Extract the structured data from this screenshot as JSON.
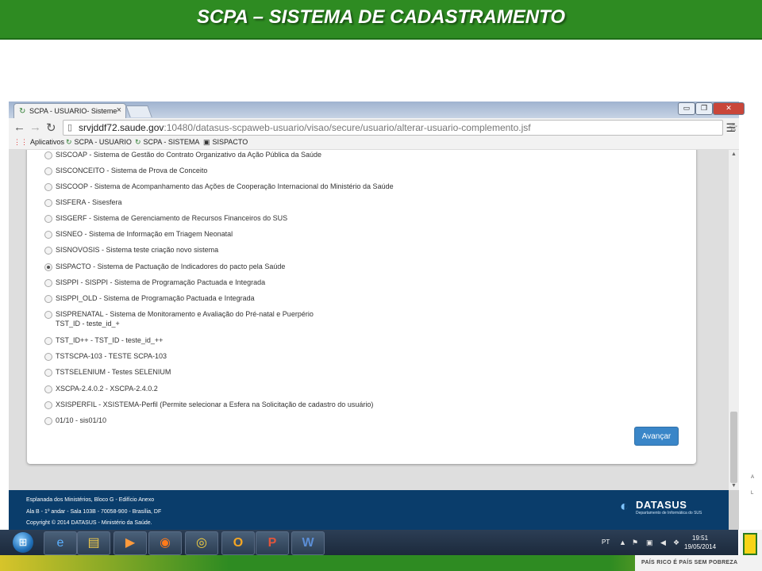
{
  "slide": {
    "title": "SCPA – SISTEMA DE CADASTRAMENTO"
  },
  "browser": {
    "tab_title": "SCPA - USUARIO- Sisteme",
    "tab_close": "×",
    "window_controls": {
      "minimize": "▭",
      "maximize": "❐",
      "close": "✕"
    },
    "url_host": "srvjddf72.saude.gov",
    "url_path": ":10480/datasus-scpaweb-usuario/visao/secure/usuario/alterar-usuario-complemento.jsf",
    "bookmarks": [
      {
        "label": "Aplicativos",
        "icon": "apps-grid-icon"
      },
      {
        "label": "SCPA - USUARIO",
        "icon": "scpa-icon"
      },
      {
        "label": "SCPA - SISTEMA",
        "icon": "scpa-icon"
      },
      {
        "label": "SISPACTO",
        "icon": "sispacto-icon"
      }
    ]
  },
  "page": {
    "systems": [
      {
        "label": "SISCOAP - Sistema de Gestão do Contrato Organizativo da Ação Pública da Saúde",
        "checked": false
      },
      {
        "label": "SISCONCEITO - Sistema de Prova de Conceito",
        "checked": false
      },
      {
        "label": "SISCOOP - Sistema de Acompanhamento das Ações de Cooperação Internacional do Ministério da Saúde",
        "checked": false
      },
      {
        "label": "SISFERA - Sisesfera",
        "checked": false
      },
      {
        "label": "SISGERF - Sistema de Gerenciamento de Recursos Financeiros do SUS",
        "checked": false
      },
      {
        "label": "SISNEO - Sistema de Informação em Triagem Neonatal",
        "checked": false
      },
      {
        "label": "SISNOVOSIS - Sistema teste criação novo sistema",
        "checked": false
      },
      {
        "label": "SISPACTO - Sistema de Pactuação de Indicadores do pacto pela Saúde",
        "checked": true
      },
      {
        "label": "SISPPI - SISPPI - Sistema de Programação Pactuada e Integrada",
        "checked": false
      },
      {
        "label": "SISPPI_OLD - Sistema de Programação Pactuada e Integrada",
        "checked": false
      },
      {
        "label": "SISPRENATAL - Sistema de Monitoramento e Avaliação do Pré-natal e Puerpério",
        "checked": false
      },
      {
        "label": "TST_ID - teste_id_+",
        "checked": false
      },
      {
        "label": "TST_ID++ - TST_ID - teste_id_++",
        "checked": false
      },
      {
        "label": "TSTSCPA-103 - TESTE SCPA-103",
        "checked": false
      },
      {
        "label": "TSTSELENIUM - Testes SELENIUM",
        "checked": false
      },
      {
        "label": "XSCPA-2.4.0.2 - XSCPA-2.4.0.2",
        "checked": false
      },
      {
        "label": "XSISPERFIL - XSISTEMA-Perfil (Permite selecionar a Esfera na Solicitação de cadastro do usuário)",
        "checked": false
      },
      {
        "label": "01/10 - sis01/10",
        "checked": false
      }
    ],
    "advance_button": "Avançar"
  },
  "footer": {
    "address_line1": "Esplanada dos Ministérios, Bloco G - Edifício Anexo",
    "address_line2": "Ala B - 1º andar - Sala 103B - 70058-900 - Brasília, DF",
    "copyright": "Copyright © 2014 DATASUS - Ministério da Saúde.",
    "logo_name": "DATASUS",
    "logo_subtitle": "Departamento de Informática do SUS"
  },
  "taskbar": {
    "apps": [
      {
        "name": "internet-explorer",
        "glyph": "e"
      },
      {
        "name": "file-explorer",
        "glyph": "▤"
      },
      {
        "name": "media-player",
        "glyph": "▶"
      },
      {
        "name": "firefox",
        "glyph": "◉"
      },
      {
        "name": "chrome",
        "glyph": "◎"
      },
      {
        "name": "outlook",
        "glyph": "O"
      },
      {
        "name": "powerpoint",
        "glyph": "P"
      },
      {
        "name": "word",
        "glyph": "W"
      }
    ],
    "language": "PT",
    "time": "19:51",
    "date": "19/05/2014"
  },
  "decor": {
    "side_letters": "A\nL",
    "gov_slogan": "PAÍS RICO É PAÍS SEM POBREZA"
  },
  "colors": {
    "header_green": "#2e8b22",
    "button_blue": "#3a86c8",
    "footer_navy": "#0a3d6b"
  }
}
